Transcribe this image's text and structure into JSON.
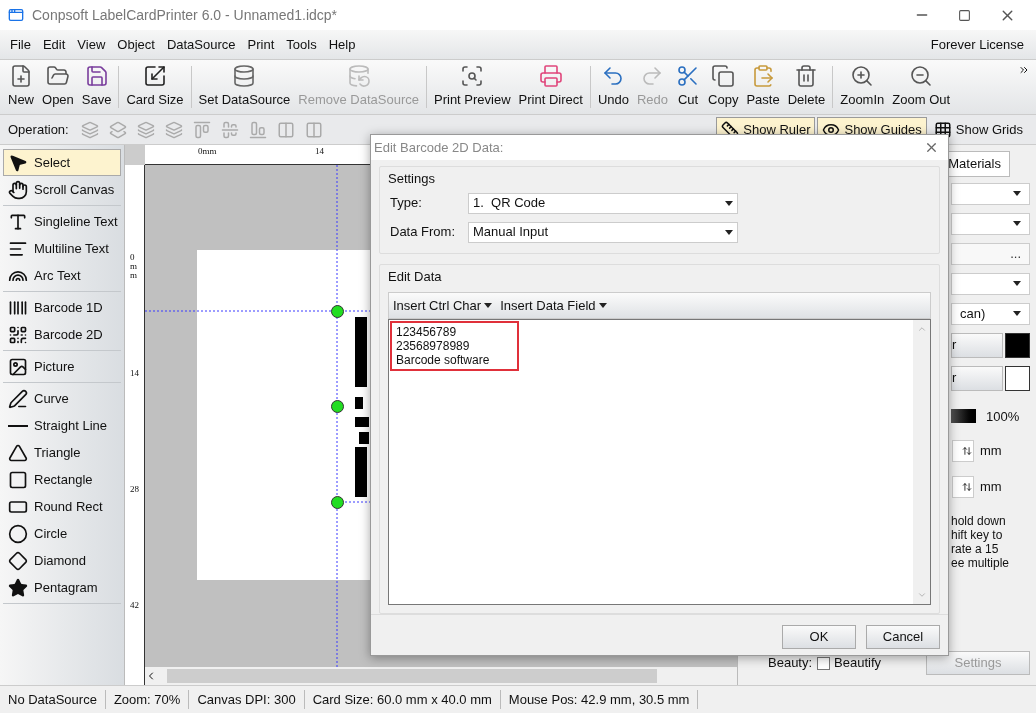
{
  "window": {
    "title": "Conpsoft LabelCardPrinter 6.0 - Unnamed1.idcp*",
    "license": "Forever License"
  },
  "menu": [
    "File",
    "Edit",
    "View",
    "Object",
    "DataSource",
    "Print",
    "Tools",
    "Help"
  ],
  "toolbar": [
    {
      "items": [
        {
          "label": "New",
          "disabled": false
        },
        {
          "label": "Open",
          "disabled": false
        },
        {
          "label": "Save",
          "disabled": false
        }
      ]
    },
    {
      "items": [
        {
          "label": "Card Size",
          "disabled": false
        }
      ]
    },
    {
      "items": [
        {
          "label": "Set DataSource",
          "disabled": false
        },
        {
          "label": "Remove DataSource",
          "disabled": true
        }
      ]
    },
    {
      "items": [
        {
          "label": "Print Preview",
          "disabled": false
        },
        {
          "label": "Print Direct",
          "disabled": false
        }
      ]
    },
    {
      "items": [
        {
          "label": "Undo",
          "disabled": false
        },
        {
          "label": "Redo",
          "disabled": true
        },
        {
          "label": "Cut",
          "disabled": false
        },
        {
          "label": "Copy",
          "disabled": false
        },
        {
          "label": "Paste",
          "disabled": false
        },
        {
          "label": "Delete",
          "disabled": false
        }
      ]
    },
    {
      "items": [
        {
          "label": "ZoomIn",
          "disabled": false
        },
        {
          "label": "Zoom Out",
          "disabled": false
        }
      ]
    }
  ],
  "operation_bar": {
    "label": "Operation:",
    "toggles": [
      {
        "label": "Show Ruler",
        "on": true
      },
      {
        "label": "Show Guides",
        "on": true
      },
      {
        "label": "Show Grids",
        "on": false
      }
    ]
  },
  "tools": [
    {
      "items": [
        {
          "label": "Select",
          "selected": true
        },
        {
          "label": "Scroll Canvas",
          "selected": false
        }
      ]
    },
    {
      "items": [
        {
          "label": "Singleline Text",
          "selected": false
        },
        {
          "label": "Multiline Text",
          "selected": false
        },
        {
          "label": "Arc Text",
          "selected": false
        }
      ]
    },
    {
      "items": [
        {
          "label": "Barcode 1D",
          "selected": false
        },
        {
          "label": "Barcode 2D",
          "selected": false
        }
      ]
    },
    {
      "items": [
        {
          "label": "Picture",
          "selected": false
        }
      ]
    },
    {
      "items": [
        {
          "label": "Curve",
          "selected": false
        },
        {
          "label": "Straight Line",
          "selected": false
        },
        {
          "label": "Triangle",
          "selected": false
        },
        {
          "label": "Rectangle",
          "selected": false
        },
        {
          "label": "Round Rect",
          "selected": false
        },
        {
          "label": "Circle",
          "selected": false
        },
        {
          "label": "Diamond",
          "selected": false
        },
        {
          "label": "Pentagram",
          "selected": false
        }
      ]
    }
  ],
  "rulers": {
    "horizontal": [
      "0mm",
      "14"
    ],
    "vertical": [
      "0mm",
      "14",
      "28",
      "42"
    ]
  },
  "right_panel": {
    "tab": "Materials",
    "rows": [
      {
        "kind": "select"
      },
      {
        "kind": "select"
      },
      {
        "kind": "browse",
        "text": "..."
      },
      {
        "kind": "select"
      },
      {
        "kind": "select",
        "text": "can)"
      },
      {
        "kind": "color",
        "text": "r",
        "color": "#000000"
      },
      {
        "kind": "color",
        "text": "r",
        "color": "#ffffff"
      },
      {
        "kind": "slider",
        "level": 1,
        "text": "100%"
      },
      {
        "kind": "spin",
        "unit": "mm"
      },
      {
        "kind": "spin",
        "unit": "mm"
      }
    ],
    "note": [
      "hold down",
      "hift key to",
      "rate a 15",
      "ee multiple"
    ],
    "beauty_label": "Beauty:",
    "beautify": {
      "label": "Beautify",
      "checked": false
    },
    "settings_button": {
      "label": "Settings",
      "disabled": true
    }
  },
  "dialog": {
    "title": "Edit Barcode 2D Data:",
    "settings_title": "Settings",
    "type_label": "Type:",
    "type_value": "1.  QR Code",
    "source_label": "Data From:",
    "source_value": "Manual Input",
    "edit_title": "Edit Data",
    "insert_buttons": [
      "Insert Ctrl Char",
      "Insert Data Field"
    ],
    "data_lines": [
      "123456789",
      "23568978989",
      "Barcode software"
    ],
    "ok": "OK",
    "cancel": "Cancel"
  },
  "status_bar": [
    "No DataSource",
    "Zoom: 70%",
    "Canvas DPI: 300",
    "Card Size: 60.0 mm x 40.0 mm",
    "Mouse Pos: 42.9 mm, 30.5 mm"
  ]
}
